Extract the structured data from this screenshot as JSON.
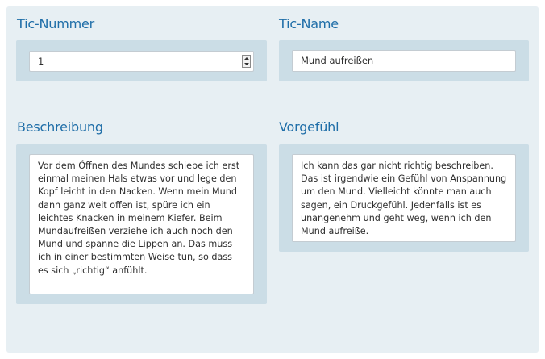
{
  "tic_nummer": {
    "label": "Tic-Nummer",
    "value": "1"
  },
  "tic_name": {
    "label": "Tic-Name",
    "value": "Mund aufreißen"
  },
  "beschreibung": {
    "label": "Beschreibung",
    "text": "Vor dem Öffnen des Mundes schiebe ich erst einmal meinen Hals etwas vor und lege den Kopf leicht in den Nacken. Wenn mein Mund dann ganz weit offen ist, spüre ich ein leichtes Knacken in meinem Kiefer. Beim Mundaufreißen verziehe ich auch noch den Mund und spanne die Lippen an. Das muss ich in einer bestimmten Weise tun, so dass es sich „richtig“ anfühlt."
  },
  "vorgefuehl": {
    "label": "Vorgefühl",
    "text": "Ich kann das gar nicht richtig beschreiben. Das ist irgendwie ein Gefühl von Anspannung um den Mund. Vielleicht könnte man auch sagen, ein Druckgefühl. Jedenfalls ist es unangenehm und geht weg, wenn ich den Mund aufreiße."
  },
  "icons": {
    "spinner_up": "arrow-up-icon",
    "spinner_down": "arrow-down-icon"
  },
  "colors": {
    "panel_background": "#e7eff3",
    "field_container": "#cbdde6",
    "label_color": "#1f6ea8"
  }
}
